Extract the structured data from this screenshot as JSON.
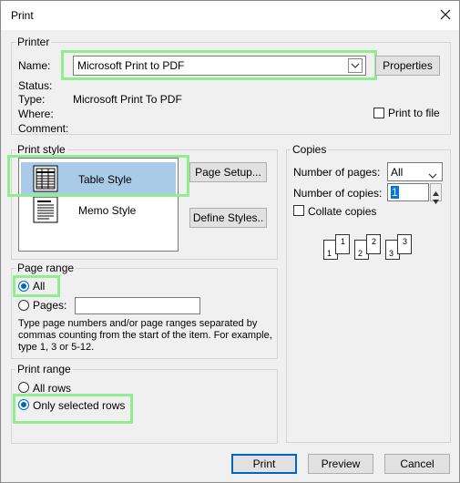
{
  "window": {
    "title": "Print",
    "close_icon": "close-icon"
  },
  "printer": {
    "group_label": "Printer",
    "name_label": "Name:",
    "name_value": "Microsoft Print to PDF",
    "properties_button": "Properties",
    "status_label": "Status:",
    "status_value": "",
    "type_label": "Type:",
    "type_value": "Microsoft Print To PDF",
    "where_label": "Where:",
    "where_value": "",
    "comment_label": "Comment:",
    "comment_value": "",
    "print_to_file_label": "Print to file",
    "print_to_file_checked": false
  },
  "print_style": {
    "group_label": "Print style",
    "items": [
      {
        "label": "Table Style",
        "selected": true,
        "icon": "table-style-icon"
      },
      {
        "label": "Memo Style",
        "selected": false,
        "icon": "memo-style-icon"
      }
    ],
    "page_setup_button": "Page Setup...",
    "define_styles_button": "Define Styles.."
  },
  "copies": {
    "group_label": "Copies",
    "number_of_pages_label": "Number of pages:",
    "number_of_pages_value": "All",
    "number_of_copies_label": "Number of copies:",
    "number_of_copies_value": "1",
    "collate_label": "Collate copies",
    "collate_checked": false,
    "collate_pages": [
      "1",
      "1",
      "2",
      "2",
      "3",
      "3"
    ]
  },
  "page_range": {
    "group_label": "Page range",
    "all_label": "All",
    "all_selected": true,
    "pages_label": "Pages:",
    "pages_value": "",
    "help_text": "Type page numbers and/or page ranges separated by commas counting from the start of the item.  For example, type 1, 3 or 5-12."
  },
  "print_range": {
    "group_label": "Print range",
    "all_rows_label": "All rows",
    "only_selected_rows_label": "Only selected rows",
    "selected": "only_selected_rows"
  },
  "footer": {
    "print_button": "Print",
    "preview_button": "Preview",
    "cancel_button": "Cancel"
  },
  "colors": {
    "highlight": "#90ee90",
    "selection": "#a9cbe8",
    "accent": "#0067c0"
  }
}
